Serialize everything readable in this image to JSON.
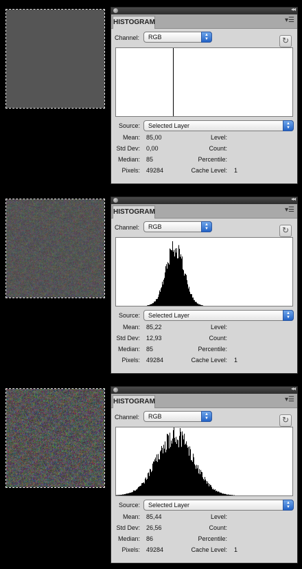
{
  "panels": [
    {
      "swatch_noise": 0,
      "panel_title": "HISTOGRAM",
      "channel_label": "Channel:",
      "channel_value": "RGB",
      "source_label": "Source:",
      "source_value": "Selected Layer",
      "stats": {
        "mean_label": "Mean:",
        "mean": "85,00",
        "stddev_label": "Std Dev:",
        "stddev": "0,00",
        "median_label": "Median:",
        "median": "85",
        "pixels_label": "Pixels:",
        "pixels": "49284",
        "level_label": "Level:",
        "level": "",
        "count_label": "Count:",
        "count": "",
        "percentile_label": "Percentile:",
        "percentile": "",
        "cache_label": "Cache Level:",
        "cache": "1"
      }
    },
    {
      "swatch_noise": 13,
      "panel_title": "HISTOGRAM",
      "channel_label": "Channel:",
      "channel_value": "RGB",
      "source_label": "Source:",
      "source_value": "Selected Layer",
      "stats": {
        "mean_label": "Mean:",
        "mean": "85,22",
        "stddev_label": "Std Dev:",
        "stddev": "12,93",
        "median_label": "Median:",
        "median": "85",
        "pixels_label": "Pixels:",
        "pixels": "49284",
        "level_label": "Level:",
        "level": "",
        "count_label": "Count:",
        "count": "",
        "percentile_label": "Percentile:",
        "percentile": "",
        "cache_label": "Cache Level:",
        "cache": "1"
      }
    },
    {
      "swatch_noise": 26,
      "panel_title": "HISTOGRAM",
      "channel_label": "Channel:",
      "channel_value": "RGB",
      "source_label": "Source:",
      "source_value": "Selected Layer",
      "stats": {
        "mean_label": "Mean:",
        "mean": "85,44",
        "stddev_label": "Std Dev:",
        "stddev": "26,56",
        "median_label": "Median:",
        "median": "86",
        "pixels_label": "Pixels:",
        "pixels": "49284",
        "level_label": "Level:",
        "level": "",
        "count_label": "Count:",
        "count": "",
        "percentile_label": "Percentile:",
        "percentile": "",
        "cache_label": "Cache Level:",
        "cache": "1"
      }
    }
  ],
  "icons": {
    "panel_menu": "panel-menu-icon",
    "refresh": "refresh-icon",
    "collapse": "collapse-icon",
    "dropdown": "dropdown-arrow-icon"
  },
  "colors": {
    "panel_bg": "#d6d6d6",
    "histogram_fill": "#000000",
    "dropdown_accent": "#2363c6"
  }
}
